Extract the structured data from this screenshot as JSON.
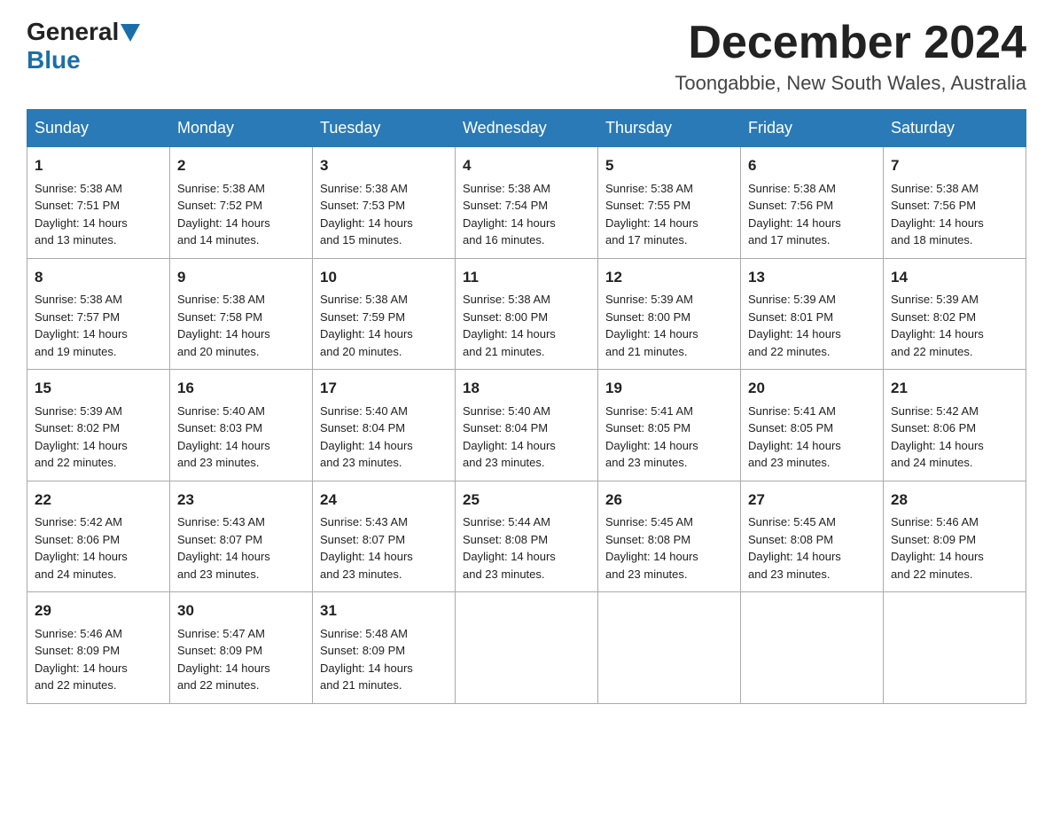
{
  "header": {
    "logo_general": "General",
    "logo_blue": "Blue",
    "title": "December 2024",
    "location": "Toongabbie, New South Wales, Australia"
  },
  "weekdays": [
    "Sunday",
    "Monday",
    "Tuesday",
    "Wednesday",
    "Thursday",
    "Friday",
    "Saturday"
  ],
  "weeks": [
    [
      {
        "day": "1",
        "sunrise": "5:38 AM",
        "sunset": "7:51 PM",
        "daylight": "14 hours and 13 minutes."
      },
      {
        "day": "2",
        "sunrise": "5:38 AM",
        "sunset": "7:52 PM",
        "daylight": "14 hours and 14 minutes."
      },
      {
        "day": "3",
        "sunrise": "5:38 AM",
        "sunset": "7:53 PM",
        "daylight": "14 hours and 15 minutes."
      },
      {
        "day": "4",
        "sunrise": "5:38 AM",
        "sunset": "7:54 PM",
        "daylight": "14 hours and 16 minutes."
      },
      {
        "day": "5",
        "sunrise": "5:38 AM",
        "sunset": "7:55 PM",
        "daylight": "14 hours and 17 minutes."
      },
      {
        "day": "6",
        "sunrise": "5:38 AM",
        "sunset": "7:56 PM",
        "daylight": "14 hours and 17 minutes."
      },
      {
        "day": "7",
        "sunrise": "5:38 AM",
        "sunset": "7:56 PM",
        "daylight": "14 hours and 18 minutes."
      }
    ],
    [
      {
        "day": "8",
        "sunrise": "5:38 AM",
        "sunset": "7:57 PM",
        "daylight": "14 hours and 19 minutes."
      },
      {
        "day": "9",
        "sunrise": "5:38 AM",
        "sunset": "7:58 PM",
        "daylight": "14 hours and 20 minutes."
      },
      {
        "day": "10",
        "sunrise": "5:38 AM",
        "sunset": "7:59 PM",
        "daylight": "14 hours and 20 minutes."
      },
      {
        "day": "11",
        "sunrise": "5:38 AM",
        "sunset": "8:00 PM",
        "daylight": "14 hours and 21 minutes."
      },
      {
        "day": "12",
        "sunrise": "5:39 AM",
        "sunset": "8:00 PM",
        "daylight": "14 hours and 21 minutes."
      },
      {
        "day": "13",
        "sunrise": "5:39 AM",
        "sunset": "8:01 PM",
        "daylight": "14 hours and 22 minutes."
      },
      {
        "day": "14",
        "sunrise": "5:39 AM",
        "sunset": "8:02 PM",
        "daylight": "14 hours and 22 minutes."
      }
    ],
    [
      {
        "day": "15",
        "sunrise": "5:39 AM",
        "sunset": "8:02 PM",
        "daylight": "14 hours and 22 minutes."
      },
      {
        "day": "16",
        "sunrise": "5:40 AM",
        "sunset": "8:03 PM",
        "daylight": "14 hours and 23 minutes."
      },
      {
        "day": "17",
        "sunrise": "5:40 AM",
        "sunset": "8:04 PM",
        "daylight": "14 hours and 23 minutes."
      },
      {
        "day": "18",
        "sunrise": "5:40 AM",
        "sunset": "8:04 PM",
        "daylight": "14 hours and 23 minutes."
      },
      {
        "day": "19",
        "sunrise": "5:41 AM",
        "sunset": "8:05 PM",
        "daylight": "14 hours and 23 minutes."
      },
      {
        "day": "20",
        "sunrise": "5:41 AM",
        "sunset": "8:05 PM",
        "daylight": "14 hours and 23 minutes."
      },
      {
        "day": "21",
        "sunrise": "5:42 AM",
        "sunset": "8:06 PM",
        "daylight": "14 hours and 24 minutes."
      }
    ],
    [
      {
        "day": "22",
        "sunrise": "5:42 AM",
        "sunset": "8:06 PM",
        "daylight": "14 hours and 24 minutes."
      },
      {
        "day": "23",
        "sunrise": "5:43 AM",
        "sunset": "8:07 PM",
        "daylight": "14 hours and 23 minutes."
      },
      {
        "day": "24",
        "sunrise": "5:43 AM",
        "sunset": "8:07 PM",
        "daylight": "14 hours and 23 minutes."
      },
      {
        "day": "25",
        "sunrise": "5:44 AM",
        "sunset": "8:08 PM",
        "daylight": "14 hours and 23 minutes."
      },
      {
        "day": "26",
        "sunrise": "5:45 AM",
        "sunset": "8:08 PM",
        "daylight": "14 hours and 23 minutes."
      },
      {
        "day": "27",
        "sunrise": "5:45 AM",
        "sunset": "8:08 PM",
        "daylight": "14 hours and 23 minutes."
      },
      {
        "day": "28",
        "sunrise": "5:46 AM",
        "sunset": "8:09 PM",
        "daylight": "14 hours and 22 minutes."
      }
    ],
    [
      {
        "day": "29",
        "sunrise": "5:46 AM",
        "sunset": "8:09 PM",
        "daylight": "14 hours and 22 minutes."
      },
      {
        "day": "30",
        "sunrise": "5:47 AM",
        "sunset": "8:09 PM",
        "daylight": "14 hours and 22 minutes."
      },
      {
        "day": "31",
        "sunrise": "5:48 AM",
        "sunset": "8:09 PM",
        "daylight": "14 hours and 21 minutes."
      },
      null,
      null,
      null,
      null
    ]
  ],
  "labels": {
    "sunrise": "Sunrise:",
    "sunset": "Sunset:",
    "daylight": "Daylight:"
  }
}
